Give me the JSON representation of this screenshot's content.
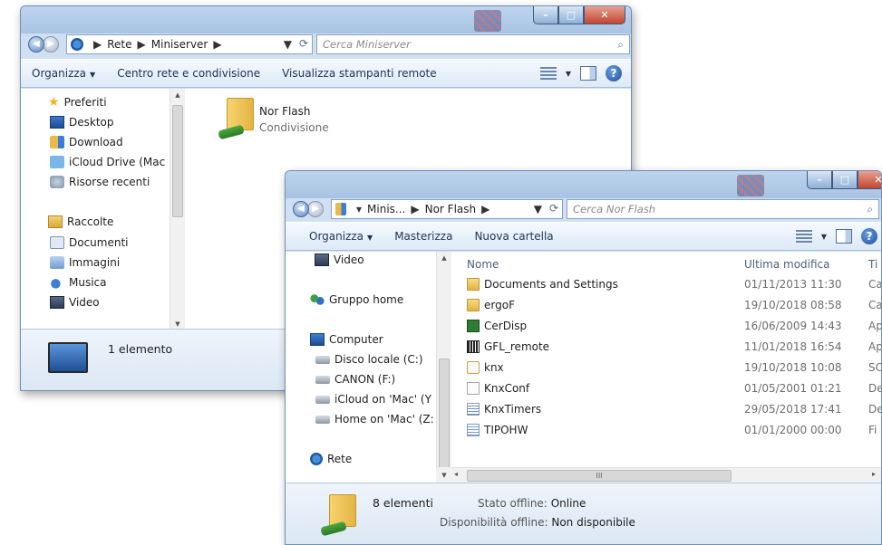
{
  "window1": {
    "breadcrumb": [
      "Rete",
      "Miniserver"
    ],
    "search_placeholder": "Cerca Miniserver",
    "toolbar": {
      "organize": "Organizza",
      "network_center": "Centro rete e condivisione",
      "printers": "Visualizza stampanti remote"
    },
    "nav": {
      "favorites": "Preferiti",
      "desktop": "Desktop",
      "download": "Download",
      "icloud": "iCloud Drive (Mac",
      "recent": "Risorse recenti",
      "libraries": "Raccolte",
      "documents": "Documenti",
      "images": "Immagini",
      "music": "Musica",
      "video": "Video"
    },
    "item": {
      "name": "Nor Flash",
      "type": "Condivisione"
    },
    "status": "1 elemento"
  },
  "window2": {
    "breadcrumb": [
      "Minis...",
      "Nor Flash"
    ],
    "search_placeholder": "Cerca Nor Flash",
    "toolbar": {
      "organize": "Organizza",
      "burn": "Masterizza",
      "new_folder": "Nuova cartella"
    },
    "nav": {
      "video": "Video",
      "homegroup": "Gruppo home",
      "computer": "Computer",
      "local_disk": "Disco locale (C:)",
      "canon": "CANON (F:)",
      "icloud_on_mac": "iCloud on 'Mac' (Y",
      "home_on_mac": "Home on 'Mac' (Z:",
      "network": "Rete"
    },
    "columns": {
      "name": "Nome",
      "modified": "Ultima modifica",
      "type": "Ti"
    },
    "files": [
      {
        "name": "Documents and Settings",
        "modified": "01/11/2013 11:30",
        "type": "Ca",
        "icon": "folder-icon"
      },
      {
        "name": "ergoF",
        "modified": "19/10/2018 08:58",
        "type": "Ca",
        "icon": "folder-icon"
      },
      {
        "name": "CerDisp",
        "modified": "16/06/2009 14:43",
        "type": "Ap",
        "icon": "application-icon"
      },
      {
        "name": "GFL_remote",
        "modified": "11/01/2018 16:54",
        "type": "Ap",
        "icon": "barcode-icon"
      },
      {
        "name": "knx",
        "modified": "19/10/2018 10:08",
        "type": "SC",
        "icon": "knx-file-icon"
      },
      {
        "name": "KnxConf",
        "modified": "01/05/2001 01:21",
        "type": "De",
        "icon": "file-icon"
      },
      {
        "name": "KnxTimers",
        "modified": "29/05/2018 17:41",
        "type": "De",
        "icon": "timers-file-icon"
      },
      {
        "name": "TIPOHW",
        "modified": "01/01/2000 00:00",
        "type": "Fi",
        "icon": "text-file-icon"
      }
    ],
    "hscroll_mark": "III",
    "status": {
      "count": "8 elementi",
      "offline_status_label": "Stato offline:",
      "offline_status_value": "Online",
      "offline_avail_label": "Disponibilità offline:",
      "offline_avail_value": "Non disponibile"
    }
  }
}
